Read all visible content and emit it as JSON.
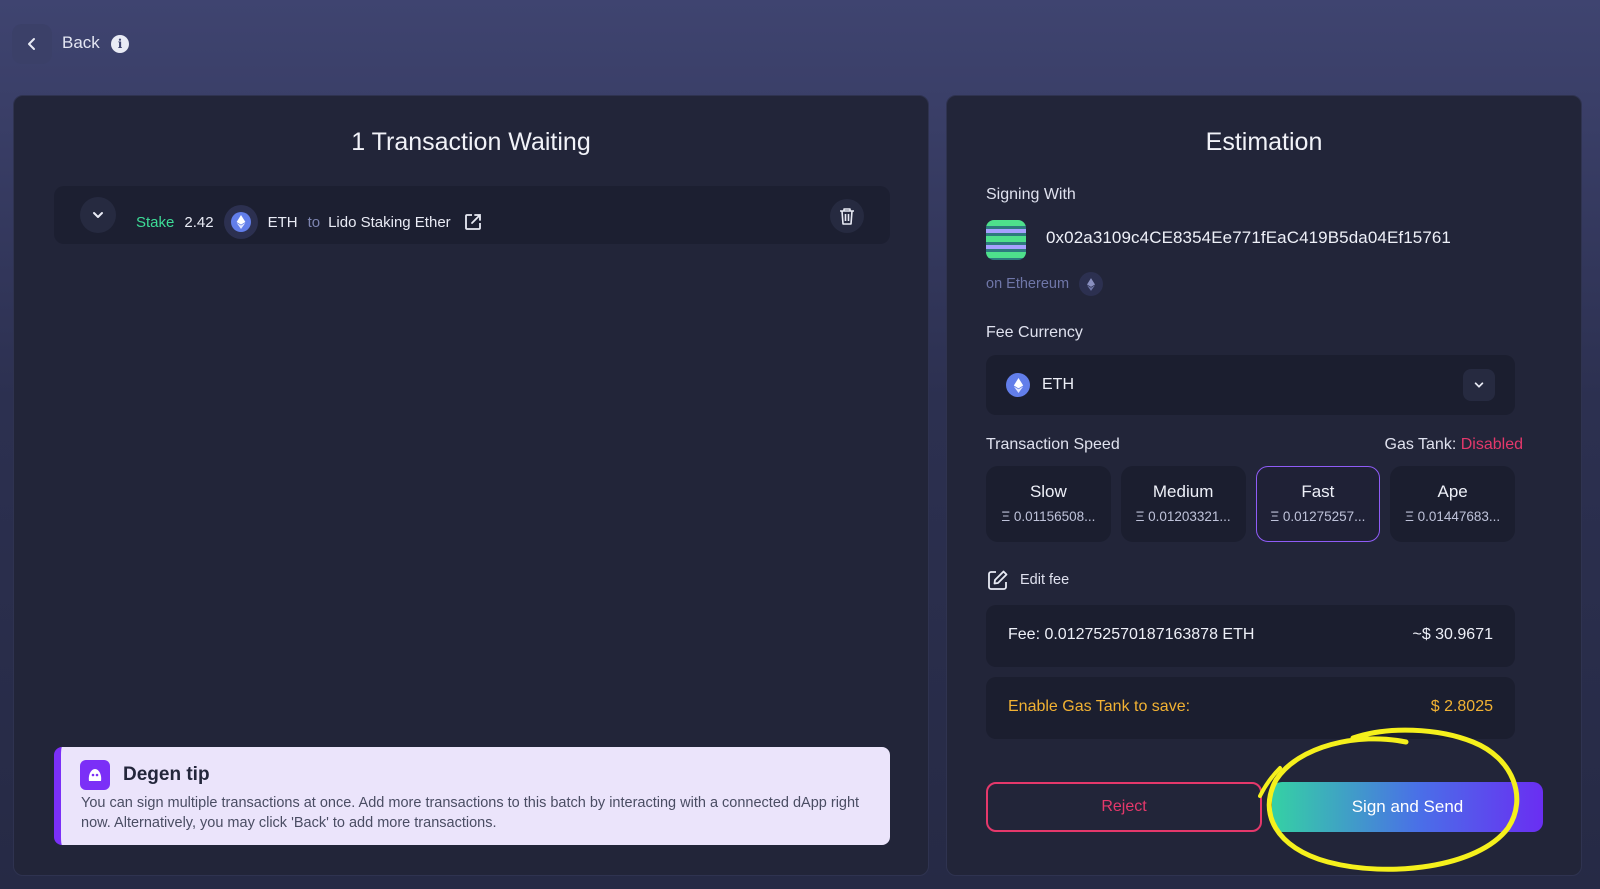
{
  "header": {
    "back_label": "Back",
    "info_glyph": "i"
  },
  "left_panel": {
    "title": "1 Transaction Waiting",
    "transaction": {
      "action": "Stake",
      "amount": "2.42",
      "token": "ETH",
      "connector": "to",
      "destination": "Lido Staking Ether"
    },
    "tip": {
      "title": "Degen tip",
      "text": "You can sign multiple transactions at once. Add more transactions to this batch by interacting with a connected dApp right now. Alternatively, you may click 'Back' to add more transactions."
    }
  },
  "right_panel": {
    "title": "Estimation",
    "signing_label": "Signing With",
    "address": "0x02a3109c4CE8354Ee771fEaC419B5da04Ef15761",
    "network": "on Ethereum",
    "fee_currency_label": "Fee Currency",
    "fee_currency_value": "ETH",
    "speed_label": "Transaction Speed",
    "gas_tank_label": "Gas Tank:",
    "gas_tank_status": "Disabled",
    "speeds": [
      {
        "name": "Slow",
        "value": "Ξ 0.01156508..."
      },
      {
        "name": "Medium",
        "value": "Ξ 0.01203321..."
      },
      {
        "name": "Fast",
        "value": "Ξ 0.01275257..."
      },
      {
        "name": "Ape",
        "value": "Ξ 0.01447683..."
      }
    ],
    "selected_speed": "Fast",
    "edit_fee_label": "Edit fee",
    "fee_amount": "Fee: 0.012752570187163878 ETH",
    "fee_usd": "~$ 30.9671",
    "save_label": "Enable Gas Tank to save:",
    "save_value": "$ 2.8025",
    "reject_label": "Reject",
    "sign_label": "Sign and Send"
  },
  "colors": {
    "accent_green": "#3ddc97",
    "danger": "#e5386b",
    "warning": "#f2b233",
    "purple": "#7b2ff7",
    "eth_blue": "#627eea",
    "highlight_yellow": "#f5f01c"
  }
}
